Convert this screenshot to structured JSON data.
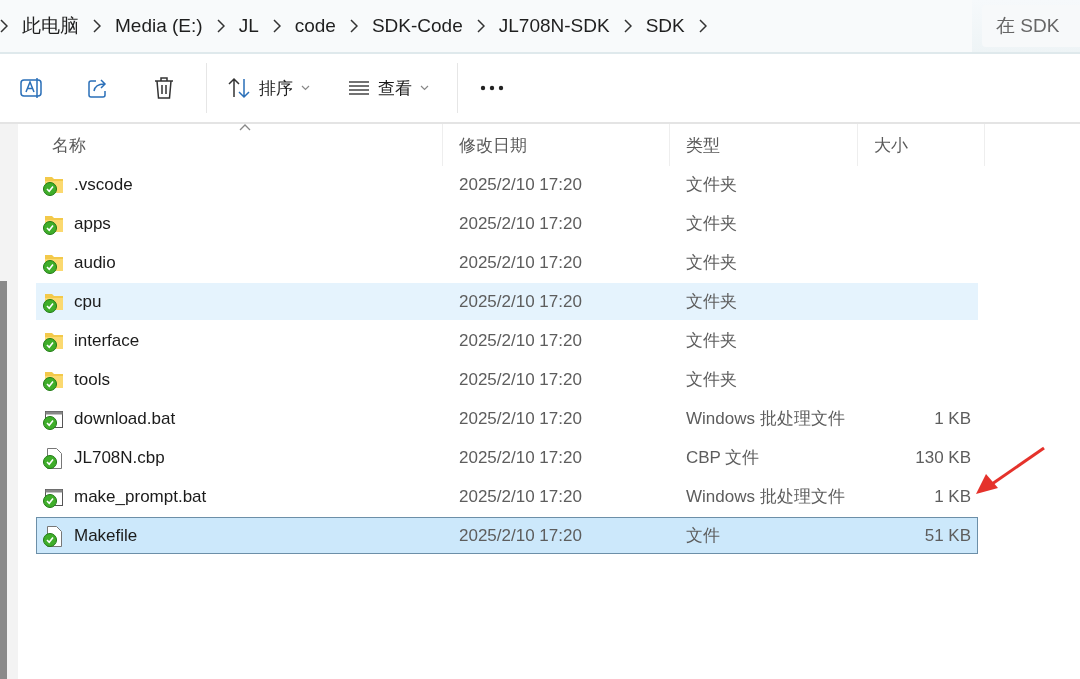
{
  "breadcrumb": [
    "此电脑",
    "Media (E:)",
    "JL",
    "code",
    "SDK-Code",
    "JL708N-SDK",
    "SDK"
  ],
  "search": {
    "placeholder": "在 SDK"
  },
  "toolbar": {
    "sort": {
      "label": "排序"
    },
    "view": {
      "label": "查看"
    }
  },
  "table": {
    "columns": [
      {
        "label": "名称",
        "sorted": true
      },
      {
        "label": "修改日期",
        "sorted": false
      },
      {
        "label": "类型",
        "sorted": false
      },
      {
        "label": "大小",
        "sorted": false
      }
    ],
    "rows": [
      {
        "kind": "folder",
        "name": ".vscode",
        "date": "2025/2/10 17:20",
        "type": "文件夹",
        "hovered": false,
        "selected": false
      },
      {
        "kind": "folder",
        "name": "apps",
        "date": "2025/2/10 17:20",
        "type": "文件夹",
        "hovered": false,
        "selected": false
      },
      {
        "kind": "folder",
        "name": "audio",
        "date": "2025/2/10 17:20",
        "type": "文件夹",
        "hovered": false,
        "selected": false
      },
      {
        "kind": "folder",
        "name": "cpu",
        "date": "2025/2/10 17:20",
        "type": "文件夹",
        "hovered": true,
        "selected": false
      },
      {
        "kind": "folder",
        "name": "interface",
        "date": "2025/2/10 17:20",
        "type": "文件夹",
        "hovered": false,
        "selected": false
      },
      {
        "kind": "folder",
        "name": "tools",
        "date": "2025/2/10 17:20",
        "type": "文件夹",
        "hovered": false,
        "selected": false
      },
      {
        "kind": "script",
        "name": "download.bat",
        "date": "2025/2/10 17:20",
        "type": "Windows 批处理文件",
        "size": "1 KB",
        "hovered": false,
        "selected": false
      },
      {
        "kind": "document",
        "name": "JL708N.cbp",
        "date": "2025/2/10 17:20",
        "type": "CBP 文件",
        "size": "130 KB",
        "hovered": false,
        "selected": false
      },
      {
        "kind": "script",
        "name": "make_prompt.bat",
        "date": "2025/2/10 17:20",
        "type": "Windows 批处理文件",
        "size": "1 KB",
        "hovered": false,
        "selected": false
      },
      {
        "kind": "document",
        "name": "Makefile",
        "date": "2025/2/10 17:20",
        "type": "文件",
        "size": "51 KB",
        "hovered": false,
        "selected": true
      }
    ]
  }
}
